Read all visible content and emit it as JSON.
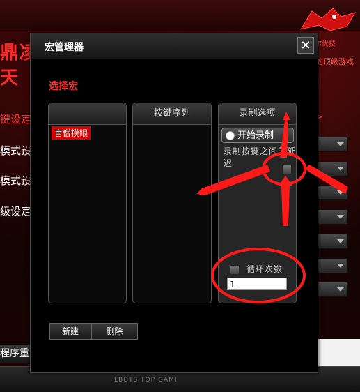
{
  "background": {
    "brand_lines": [
      "鼎凌",
      "天"
    ],
    "logo_text": "达尔优技",
    "right_subtitle": "的顶级游戏",
    "menu": [
      "键设定",
      "模式设",
      "模式设",
      "级设定"
    ],
    "arrow_label": ">",
    "bottom_button": "程序重置",
    "footer_text": "LBOTS TOP GAMI"
  },
  "dialog": {
    "title": "宏管理器",
    "close_label": "✕",
    "section_label": "选择宏",
    "macro_list": {
      "header": "",
      "items": [
        "盲僧摸眼"
      ]
    },
    "key_sequence": {
      "header": "按键序列"
    },
    "record_options": {
      "header": "录制选项",
      "start_record_label": "开始录制",
      "delay_label": "录制按键之间的延迟",
      "loop_label": "循环次数",
      "loop_value": "1"
    },
    "buttons": {
      "new_label": "新建",
      "delete_label": "删除"
    }
  },
  "colors": {
    "accent": "#ff2a2a",
    "selection": "#d50000",
    "annotation": "#ff1a1a"
  }
}
